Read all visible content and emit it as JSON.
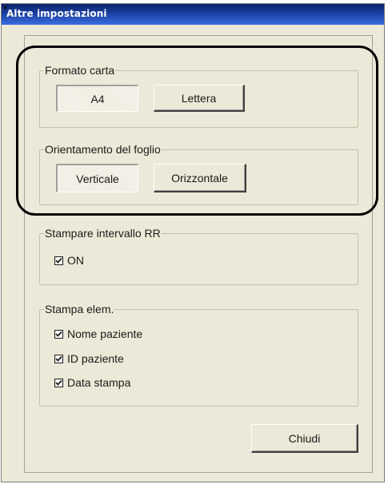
{
  "window": {
    "title": "Altre impostazioni"
  },
  "paper_format": {
    "legend": "Formato carta",
    "options": [
      "A4",
      "Lettera"
    ],
    "selected": "A4"
  },
  "orientation": {
    "legend": "Orientamento del foglio",
    "options": [
      "Verticale",
      "Orizzontale"
    ],
    "selected": "Verticale"
  },
  "rr_interval": {
    "legend": "Stampare intervallo RR",
    "items": [
      {
        "label": "ON",
        "checked": true
      }
    ]
  },
  "print_elements": {
    "legend": "Stampa elem.",
    "items": [
      {
        "label": "Nome paziente",
        "checked": true
      },
      {
        "label": "ID paziente",
        "checked": true
      },
      {
        "label": "Data stampa",
        "checked": true
      }
    ]
  },
  "footer": {
    "close_label": "Chiudi"
  },
  "colors": {
    "title_bar": "#0a246a",
    "dialog_face": "#ece9d8",
    "highlight_outline": "#000000"
  }
}
